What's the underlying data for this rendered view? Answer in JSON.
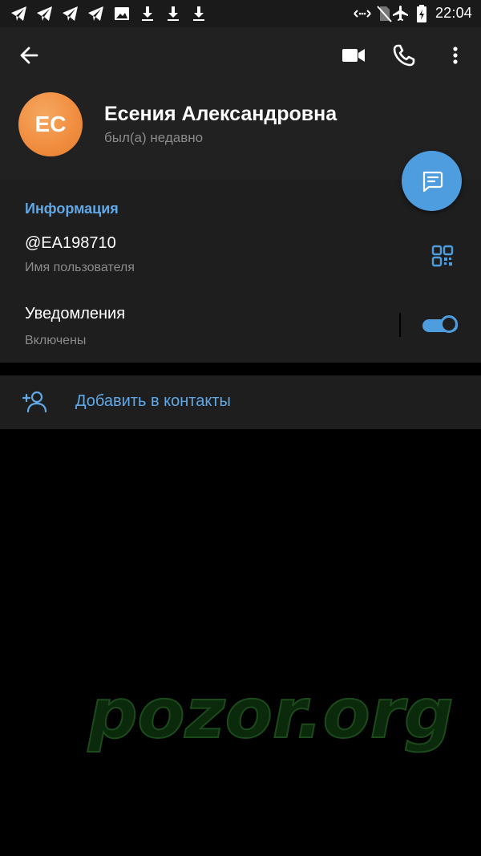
{
  "status_bar": {
    "time": "22:04",
    "left_icons": [
      "telegram-icon",
      "telegram-icon",
      "telegram-icon",
      "telegram-icon",
      "image-icon",
      "download-icon",
      "download-icon",
      "download-icon"
    ],
    "right_icons": [
      "data-transfer-icon",
      "no-sim-icon",
      "airplane-mode-icon",
      "battery-icon"
    ]
  },
  "header": {
    "avatar_initials": "ЕС",
    "name": "Есения Александровна",
    "last_seen": "был(а) недавно",
    "actions": [
      "back-icon",
      "video-call-icon",
      "phone-icon",
      "more-icon"
    ]
  },
  "info": {
    "section_title": "Информация",
    "username": "@EA198710",
    "username_caption": "Имя пользователя",
    "notifications_label": "Уведомления",
    "notifications_state": "Включены",
    "notifications_enabled": true
  },
  "add_contact": {
    "label": "Добавить в контакты"
  },
  "watermark": "pozor.org",
  "colors": {
    "accent": "#4e9ddf",
    "link": "#60a8e6",
    "avatar": "#f08c3e",
    "header_bg": "#212121",
    "section_bg": "#1e1e1e"
  }
}
